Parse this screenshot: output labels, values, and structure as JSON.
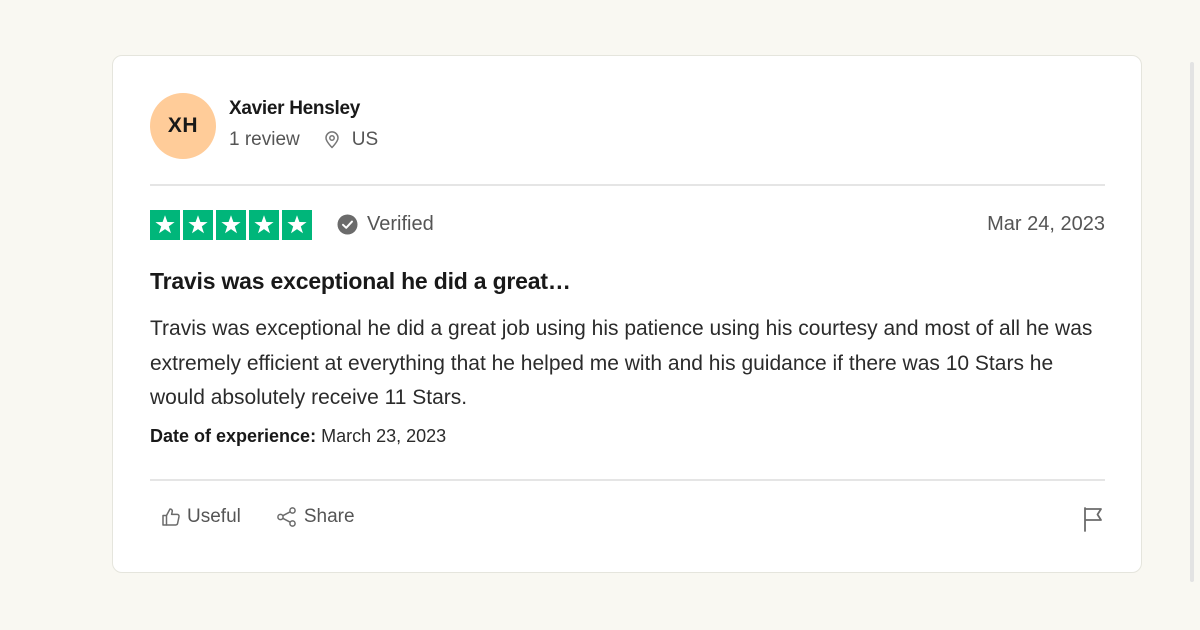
{
  "consumer": {
    "initials": "XH",
    "avatar_color": "#ffcc99",
    "name": "Xavier Hensley",
    "review_count": "1 review",
    "location": "US",
    "location_icon": "location-pin-icon"
  },
  "review": {
    "rating": 5,
    "max_rating": 5,
    "star_color": "#00b67a",
    "star_icon": "star-icon",
    "verified_label": "Verified",
    "verified_icon": "verified-check-icon",
    "date": "Mar 24, 2023",
    "title": "Travis was exceptional he did a great…",
    "body": "Travis was exceptional he did a great job using his patience using his courtesy and most of all he was extremely efficient at everything that he helped me with and his guidance if there was 10 Stars he would absolutely receive 11 Stars.",
    "experience_label": "Date of experience:",
    "experience_date": "March 23, 2023"
  },
  "actions": {
    "useful_label": "Useful",
    "useful_icon": "thumbs-up-icon",
    "share_label": "Share",
    "share_icon": "share-icon",
    "flag_icon": "flag-icon"
  }
}
